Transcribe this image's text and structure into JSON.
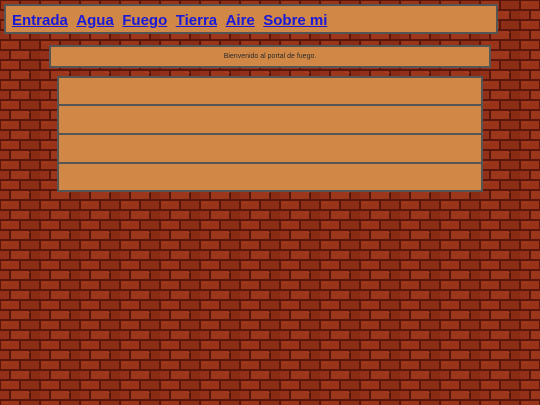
{
  "nav": {
    "links": [
      "Entrada",
      "Agua",
      "Fuego",
      "Tierra",
      "Aire",
      "Sobre mi"
    ]
  },
  "main": {
    "welcome_text": "Bienvenido al portal de fuego."
  },
  "colors": {
    "panel": "#d18847",
    "border": "#555555",
    "link": "#1a1ad6",
    "brick": "#8f2f17",
    "mortar": "#5a160a"
  }
}
